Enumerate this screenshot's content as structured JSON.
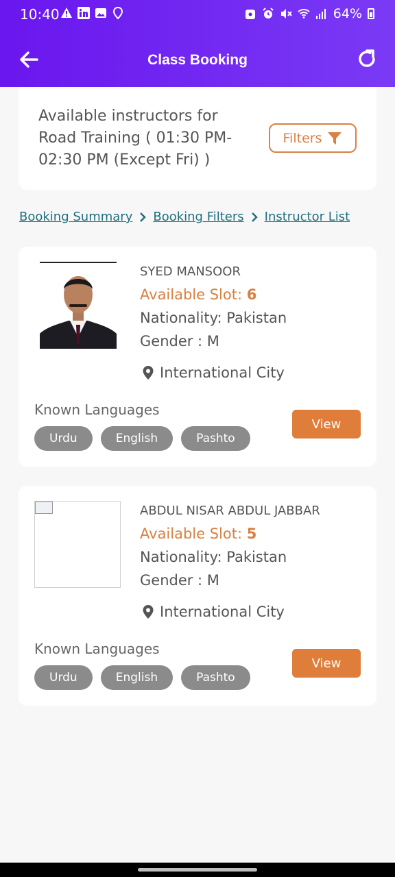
{
  "status_bar": {
    "time": "10:40",
    "battery": "64%"
  },
  "header": {
    "title": "Class Booking"
  },
  "availability": {
    "text": "Available instructors for Road Training ( 01:30 PM-02:30 PM (Except Fri) )",
    "filters_label": "Filters"
  },
  "breadcrumb": {
    "items": [
      "Booking Summary",
      "Booking Filters",
      "Instructor List"
    ]
  },
  "instructors": [
    {
      "name": "SYED MANSOOR",
      "slot_label": "Available Slot:",
      "slot_value": "6",
      "nationality": "Nationality: Pakistan",
      "gender": "Gender : M",
      "location": "International City",
      "known_label": "Known Languages",
      "languages": [
        "Urdu",
        "English",
        "Pashto"
      ],
      "view_label": "View"
    },
    {
      "name": "ABDUL NISAR ABDUL JABBAR",
      "slot_label": "Available Slot:",
      "slot_value": "5",
      "nationality": "Nationality: Pakistan",
      "gender": "Gender : M",
      "location": "International City",
      "known_label": "Known Languages",
      "languages": [
        "Urdu",
        "English",
        "Pashto"
      ],
      "view_label": "View"
    }
  ],
  "colors": {
    "header_gradient_start": "#6a16ee",
    "accent_orange": "#df7e3b",
    "link_teal": "#1f6f7d",
    "chip_gray": "#8b8b8b"
  }
}
